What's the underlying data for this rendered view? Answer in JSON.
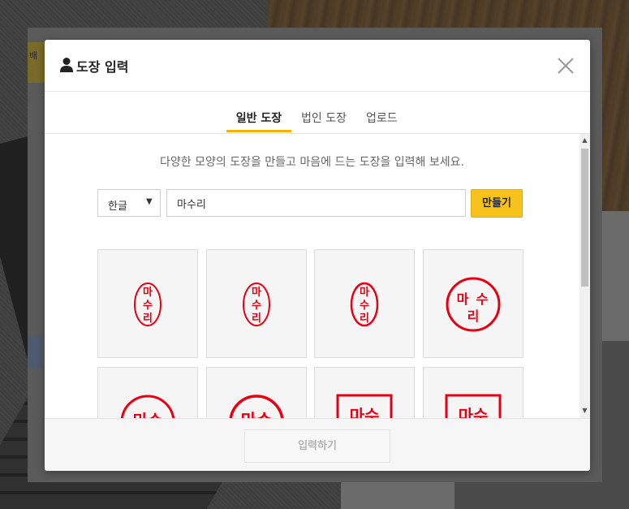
{
  "modal": {
    "title": "도장 입력",
    "close_icon": "close-icon",
    "user_icon": "user-icon"
  },
  "tabs": [
    {
      "label": "일반 도장",
      "active": true
    },
    {
      "label": "법인 도장",
      "active": false
    },
    {
      "label": "업로드",
      "active": false
    }
  ],
  "guide_text": "다양한 모양의 도장을 만들고 마음에 드는 도장을 입력해 보세요.",
  "form": {
    "language_select": "한글",
    "name_value": "마수리",
    "make_button": "만들기"
  },
  "stamps": [
    {
      "style": "oval-vertical-script",
      "text": "마수리"
    },
    {
      "style": "oval-vertical",
      "text": "마수리"
    },
    {
      "style": "oval-vertical-bold",
      "text": "마수리"
    },
    {
      "style": "circle-square-script",
      "text": "마수리"
    },
    {
      "style": "circle-horizontal",
      "text": "마수"
    },
    {
      "style": "circle-horizontal-bold",
      "text": "마수"
    },
    {
      "style": "square-script",
      "text": "마수"
    },
    {
      "style": "square-horizontal",
      "text": "마수"
    }
  ],
  "footer": {
    "submit_button": "입력하기"
  },
  "colors": {
    "accent": "#f8c21c",
    "stamp_red": "#e60012"
  },
  "background": {
    "partial_label": "배"
  }
}
